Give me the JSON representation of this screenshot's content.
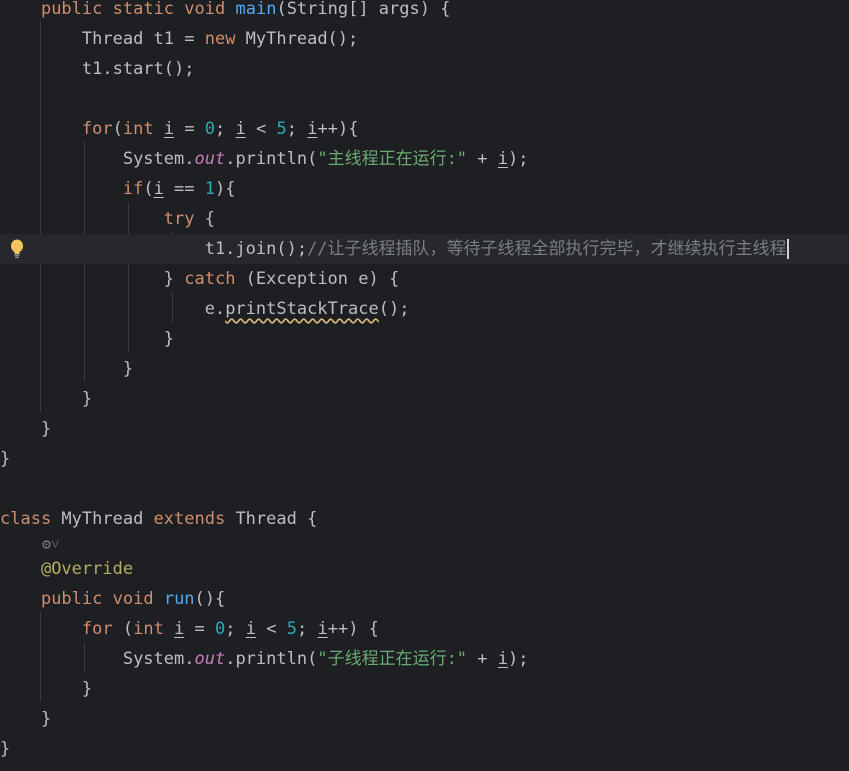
{
  "editor": {
    "main_sig": {
      "k1": "public",
      "k2": "static",
      "k3": "void",
      "name": "main",
      "rest": "(String[] args) {"
    },
    "thread_decl": {
      "a": "Thread t1 = ",
      "kw": "new",
      "b": " MyThread();"
    },
    "start_call": "t1.start();",
    "for1": {
      "kw": "for",
      "p1": "(",
      "t": "int",
      "sp": " ",
      "v1": "i",
      "eq": " = ",
      "n0": "0",
      "semi1": "; ",
      "v2": "i",
      "lt": " < ",
      "n5": "5",
      "semi2": "; ",
      "v3": "i",
      "end": "++){"
    },
    "println1": {
      "a": "System.",
      "field": "out",
      "b": ".println(",
      "str": "\"主线程正在运行:\"",
      "c": " + ",
      "v": "i",
      "d": ");"
    },
    "if_line": {
      "kw": "if",
      "a": "(",
      "v": "i",
      "b": " == ",
      "n": "1",
      "c": "){"
    },
    "try_line": {
      "kw": "try",
      "rest": " {"
    },
    "join_line": {
      "code": "t1.join();",
      "comment": "//让子线程插队，等待子线程全部执行完毕，才继续执行主线程"
    },
    "catch_line": {
      "a": "} ",
      "kw": "catch",
      "b": " (Exception e) {"
    },
    "print_trace": {
      "a": "e.",
      "warn": "printStackTrace",
      "b": "();"
    },
    "brace_close": "}",
    "class_line": {
      "k1": "class",
      "a": " MyThread ",
      "k2": "extends",
      "b": " Thread {"
    },
    "gear_glyph": "⚙˅",
    "override": "@Override",
    "run_sig": {
      "k1": "public",
      "k2": "void",
      "name": "run",
      "rest": "(){"
    },
    "for2": {
      "kw": "for",
      "p1": " (",
      "t": "int",
      "sp": " ",
      "v1": "i",
      "eq": " = ",
      "n0": "0",
      "semi1": "; ",
      "v2": "i",
      "lt": " < ",
      "n5": "5",
      "semi2": "; ",
      "v3": "i",
      "end": "++) {"
    },
    "println2": {
      "a": "System.",
      "field": "out",
      "b": ".println(",
      "str": "\"子线程正在运行:\"",
      "c": " + ",
      "v": "i",
      "d": ");"
    }
  },
  "icons": {
    "intention": "lightbulb-icon",
    "gutter": "implement-gear-icon"
  },
  "colors": {
    "background": "#1e1f22",
    "keyword": "#cf8e6d",
    "method": "#56a8f5",
    "string": "#6aab73",
    "number": "#2aacb8",
    "field": "#c77dbb",
    "annotation": "#b3ae60",
    "comment": "#7a7e85",
    "text": "#bcbec4",
    "bulb": "#f2c55c"
  }
}
